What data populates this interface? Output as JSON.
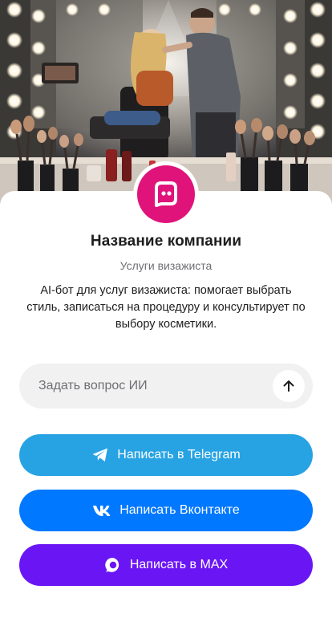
{
  "hero": {
    "image_description_icon": "makeup-studio-illustration"
  },
  "company": {
    "name": "Название компании",
    "subtitle": "Услуги визажиста",
    "description": "AI-бот для услуг визажиста: помогает выбрать стиль, записаться на процедуру и консультирует по выбору косметики.",
    "logo_icon": "chat-bubble-icon",
    "logo_color": "#e0137a"
  },
  "ask": {
    "placeholder": "Задать вопрос ИИ",
    "send_icon": "arrow-up-icon"
  },
  "buttons": {
    "telegram": {
      "label": "Написать в Telegram",
      "icon": "telegram-icon",
      "color": "#27a3e4"
    },
    "vk": {
      "label": "Написать Вконтакте",
      "icon": "vk-icon",
      "color": "#0078ff"
    },
    "max": {
      "label": "Написать в MAX",
      "icon": "max-icon",
      "color": "#6a16f4"
    }
  }
}
